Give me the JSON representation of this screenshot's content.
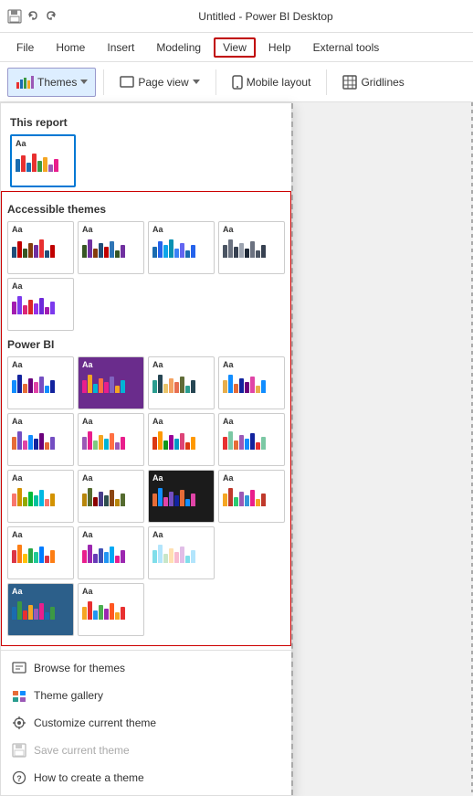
{
  "titleBar": {
    "icons": [
      "save",
      "undo",
      "redo"
    ],
    "title": "Untitled - Power BI Desktop"
  },
  "menuBar": {
    "items": [
      {
        "label": "File",
        "active": false
      },
      {
        "label": "Home",
        "active": false
      },
      {
        "label": "Insert",
        "active": false
      },
      {
        "label": "Modeling",
        "active": false
      },
      {
        "label": "View",
        "active": true
      },
      {
        "label": "Help",
        "active": false
      },
      {
        "label": "External tools",
        "active": false
      }
    ]
  },
  "ribbon": {
    "themes_label": "Themes",
    "page_view_label": "Page view",
    "mobile_layout_label": "Mobile layout",
    "gridlines_label": "Gridlines"
  },
  "dropdown": {
    "thisReport": {
      "title": "This report",
      "card": {
        "label": "Aa",
        "colors": [
          "#1a6cb0",
          "#e83030",
          "#3c9943",
          "#f5a623",
          "#9b59b6",
          "#e91e8c"
        ]
      }
    },
    "accessibleThemes": {
      "title": "Accessible themes",
      "cards": [
        {
          "label": "Aa",
          "colors": [
            "#1f4e79",
            "#c00000",
            "#375623",
            "#843c0c",
            "#7030a0",
            "#e83030"
          ],
          "bg": "#fff"
        },
        {
          "label": "Aa",
          "colors": [
            "#375623",
            "#7030a0",
            "#843c0c",
            "#1f4e79",
            "#c00000",
            "#2e75b6"
          ],
          "bg": "#fff"
        },
        {
          "label": "Aa",
          "colors": [
            "#1a6cb0",
            "#2563eb",
            "#0ea5e9",
            "#0891b2",
            "#3b82f6",
            "#6366f1"
          ],
          "bg": "#fff"
        },
        {
          "label": "Aa",
          "colors": [
            "#4b5563",
            "#6b7280",
            "#374151",
            "#9ca3af",
            "#1f2937",
            "#111827"
          ],
          "bg": "#fff"
        },
        {
          "label": "Aa",
          "colors": [
            "#a21caf",
            "#7c3aed",
            "#db2777",
            "#dc2626",
            "#9333ea",
            "#6d28d9"
          ],
          "bg": "#fff"
        }
      ]
    },
    "powerBI": {
      "title": "Power BI",
      "cards": [
        {
          "label": "Aa",
          "colors": [
            "#118dff",
            "#12239e",
            "#e66c37",
            "#6b007b",
            "#e044a7",
            "#744ec2"
          ],
          "bg": "#fff"
        },
        {
          "label": "Aa",
          "colors": [
            "#8063bf",
            "#e91e8c",
            "#f4a522",
            "#00b4d5",
            "#2c6fad",
            "#ff7043"
          ],
          "bg": "#6a2c8c",
          "textWhite": true
        },
        {
          "label": "Aa",
          "colors": [
            "#2a9d8f",
            "#264653",
            "#e9c46a",
            "#f4a261",
            "#e76f51",
            "#606c38"
          ],
          "bg": "#fff"
        },
        {
          "label": "Aa",
          "colors": [
            "#e8ae4c",
            "#118dff",
            "#e66c37",
            "#12239e",
            "#6b007b",
            "#e044a7"
          ],
          "bg": "#fff"
        },
        {
          "label": "Aa",
          "colors": [
            "#e66c37",
            "#744ec2",
            "#e044a7",
            "#118dff",
            "#12239e",
            "#6b007b"
          ],
          "bg": "#fff"
        },
        {
          "label": "Aa",
          "colors": [
            "#9b59b6",
            "#e91e8c",
            "#7fc97f",
            "#f4a522",
            "#00b4d5",
            "#ff7043"
          ],
          "bg": "#fff"
        },
        {
          "label": "Aa",
          "colors": [
            "#dc3912",
            "#ff9900",
            "#109618",
            "#990099",
            "#0099c6",
            "#dd4477"
          ],
          "bg": "#fff"
        },
        {
          "label": "Aa",
          "colors": [
            "#e83030",
            "#7bc8a4",
            "#e66c37",
            "#9b59b6",
            "#118dff",
            "#12239e"
          ],
          "bg": "#fff"
        },
        {
          "label": "Aa",
          "colors": [
            "#f8766d",
            "#d39200",
            "#93aa00",
            "#00ba38",
            "#00c19f",
            "#00b9e3"
          ],
          "bg": "#fff"
        },
        {
          "label": "Aa",
          "colors": [
            "#b8860b",
            "#556b2f",
            "#8b0000",
            "#483d8b",
            "#2f4f4f",
            "#8b4513"
          ],
          "bg": "#fff"
        },
        {
          "label": "Aa",
          "colors": [
            "#1b1b1b",
            "#e66c37",
            "#118dff",
            "#e044a7",
            "#744ec2",
            "#12239e"
          ],
          "bg": "#1b1b1b",
          "textWhite": true
        },
        {
          "label": "Aa",
          "colors": [
            "#f5a623",
            "#c0392b",
            "#2ecc71",
            "#9b59b6",
            "#3498db",
            "#e91e8c"
          ],
          "bg": "#fff"
        },
        {
          "label": "Aa",
          "colors": [
            "#dc3545",
            "#fd7e14",
            "#ffc107",
            "#28a745",
            "#20c997",
            "#007bff"
          ],
          "bg": "#fff"
        },
        {
          "label": "Aa",
          "colors": [
            "#e91e8c",
            "#9c27b0",
            "#673ab7",
            "#3f51b5",
            "#2196f3",
            "#03a9f4"
          ],
          "bg": "#fff"
        },
        {
          "label": "Aa",
          "colors": [
            "#80deea",
            "#b3e5fc",
            "#c8e6c9",
            "#ffe0b2",
            "#f8bbd0",
            "#e1bee7"
          ],
          "bg": "#fff"
        },
        {
          "label": "Aa",
          "colors": [
            "#1a6cb0",
            "#3c9943",
            "#e83030",
            "#f5a623",
            "#9b59b6",
            "#e91e8c"
          ],
          "bg": "#2c5f8a",
          "textWhite": true
        },
        {
          "label": "Aa",
          "colors": [
            "#f5a623",
            "#e83030",
            "#2196f3",
            "#4caf50",
            "#9c27b0",
            "#ff5722"
          ],
          "bg": "#fff"
        }
      ]
    },
    "bottomMenu": [
      {
        "label": "Browse for themes",
        "icon": "browse",
        "disabled": false
      },
      {
        "label": "Theme gallery",
        "icon": "gallery",
        "disabled": false
      },
      {
        "label": "Customize current theme",
        "icon": "customize",
        "disabled": false
      },
      {
        "label": "Save current theme",
        "icon": "save-theme",
        "disabled": true
      },
      {
        "label": "How to create a theme",
        "icon": "help-circle",
        "disabled": false
      }
    ]
  }
}
